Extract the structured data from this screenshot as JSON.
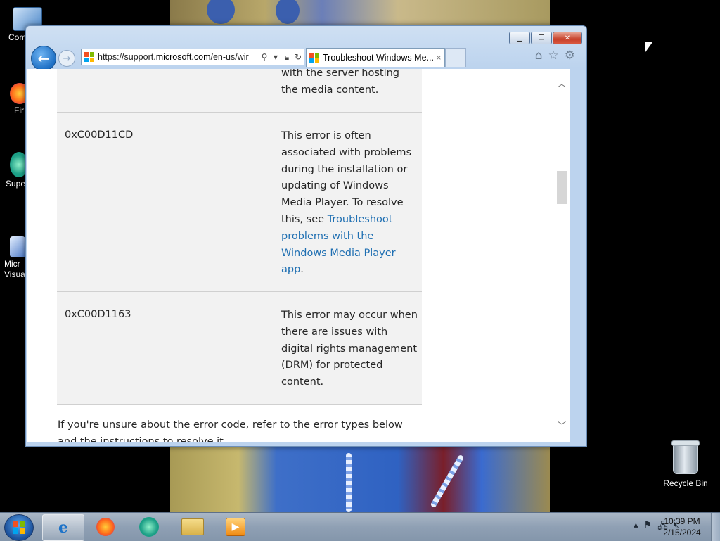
{
  "desktop": {
    "icons": [
      {
        "label": "Com",
        "icon": "computer-icon"
      },
      {
        "label": "Fir",
        "icon": "firefox-icon"
      },
      {
        "label": "Supe",
        "icon": "app-icon"
      },
      {
        "label": "Micr\nVisual",
        "icon": "visual-studio-icon"
      }
    ],
    "recycle_bin": "Recycle Bin"
  },
  "browser": {
    "url_prefix": "https://support.",
    "url_domain": "microsoft.com",
    "url_suffix": "/en-us/wir",
    "tab_title": "Troubleshoot Windows Me...",
    "tab_close": "×"
  },
  "page": {
    "partial_top_text": "with the server hosting the media content.",
    "rows": [
      {
        "code": "0xC00D11CD",
        "text": "This error is often associated with problems during the installation or updating of Windows Media Player. To resolve this, see ",
        "link": "Troubleshoot problems with the Windows Media Player app",
        "text_after": "."
      },
      {
        "code": "0xC00D1163",
        "text": "This error may occur when there are issues with digital rights management (DRM) for protected content."
      }
    ],
    "after_table": "If you're unsure about the error code, refer to the error types below and the instructions to resolve it."
  },
  "taskbar": {
    "time": "10:39 PM",
    "date": "2/15/2024"
  },
  "colors": {
    "link": "#1f6fb2",
    "table_bg": "#f2f2f2",
    "back_button": "#1d6fc4"
  }
}
